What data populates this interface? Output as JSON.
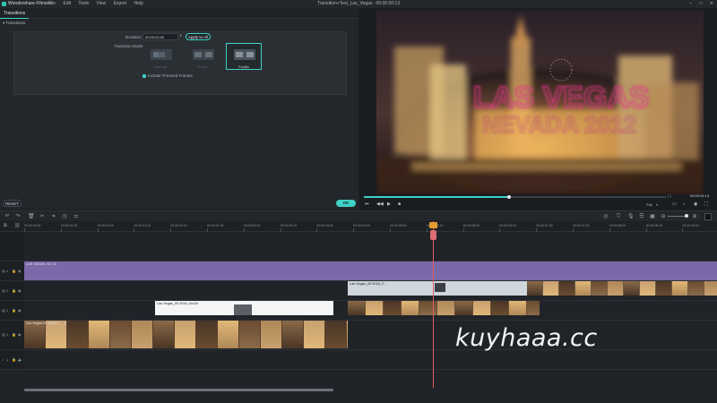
{
  "app": {
    "name": "Wondershare Filmora",
    "window_title": "Transition+Text_Las_Vegas : 00:00:00:13",
    "menu": [
      "File",
      "Edit",
      "Tools",
      "View",
      "Export",
      "Help"
    ]
  },
  "panel": {
    "tab": "Transitions",
    "section": "Transitions",
    "duration_label": "Duration:",
    "duration_value": "00:00:02:00",
    "apply_all": "Apply to All",
    "mode_label": "Transition Mode:",
    "modes": [
      "Overlap",
      "Prefix",
      "Postfix"
    ],
    "selected_mode": "Postfix",
    "include_trimmed": "Include Trimmed Frames",
    "include_trimmed_checked": true,
    "reset": "RESET",
    "ok": "OK"
  },
  "preview": {
    "overlay_line1": "LAS VEGAS",
    "overlay_line2": "NEVADA 2012",
    "progress": 0.48,
    "timecode": "00:00:04:13",
    "quality": "Full"
  },
  "timeline": {
    "ruler": [
      "00:00:00:00",
      "00:00:00:15",
      "00:00:01:00",
      "00:00:01:15",
      "00:00:02:00",
      "00:00:02:15",
      "00:00:03:00",
      "00:00:03:15",
      "00:00:04:00",
      "00:00:04:15",
      "00:00:05:00",
      "00:00:05:15",
      "00:00:06:00",
      "00:00:06:15",
      "00:00:07:00",
      "00:00:07:15",
      "00:00:08:00",
      "00:00:08:15",
      "00:00:09:00",
      "00:00:09:15"
    ],
    "clips": {
      "title": "LAS VEGAS, NV 12",
      "video2": "Las Vegas_09 2018_0...",
      "video1": "Las Vegas_09 2018_0xx29",
      "video0": "Las Vegas 09 2018_0 ..._0"
    },
    "track_numbers": [
      "4",
      "3",
      "2",
      "1"
    ],
    "audio_track": "1"
  },
  "watermark": "kuyhaaa.cc",
  "colors": {
    "accent": "#3fd1c6",
    "title_clip": "#7b68a8",
    "playhead": "#e55b63",
    "neon_pink": "#e0378b"
  },
  "icons": [
    "undo-icon",
    "redo-icon",
    "delete-icon",
    "cut-icon",
    "crop-icon",
    "speed-icon",
    "adjust-icon",
    "color-icon",
    "render-icon",
    "marker-icon",
    "voiceover-icon",
    "snapshot-icon",
    "volume-icon",
    "zoom-out-icon",
    "zoom-in-icon",
    "play-icon",
    "prev-frame-icon",
    "next-frame-icon",
    "stop-icon",
    "fullscreen-icon",
    "eye-icon",
    "lock-icon",
    "speaker-icon"
  ]
}
